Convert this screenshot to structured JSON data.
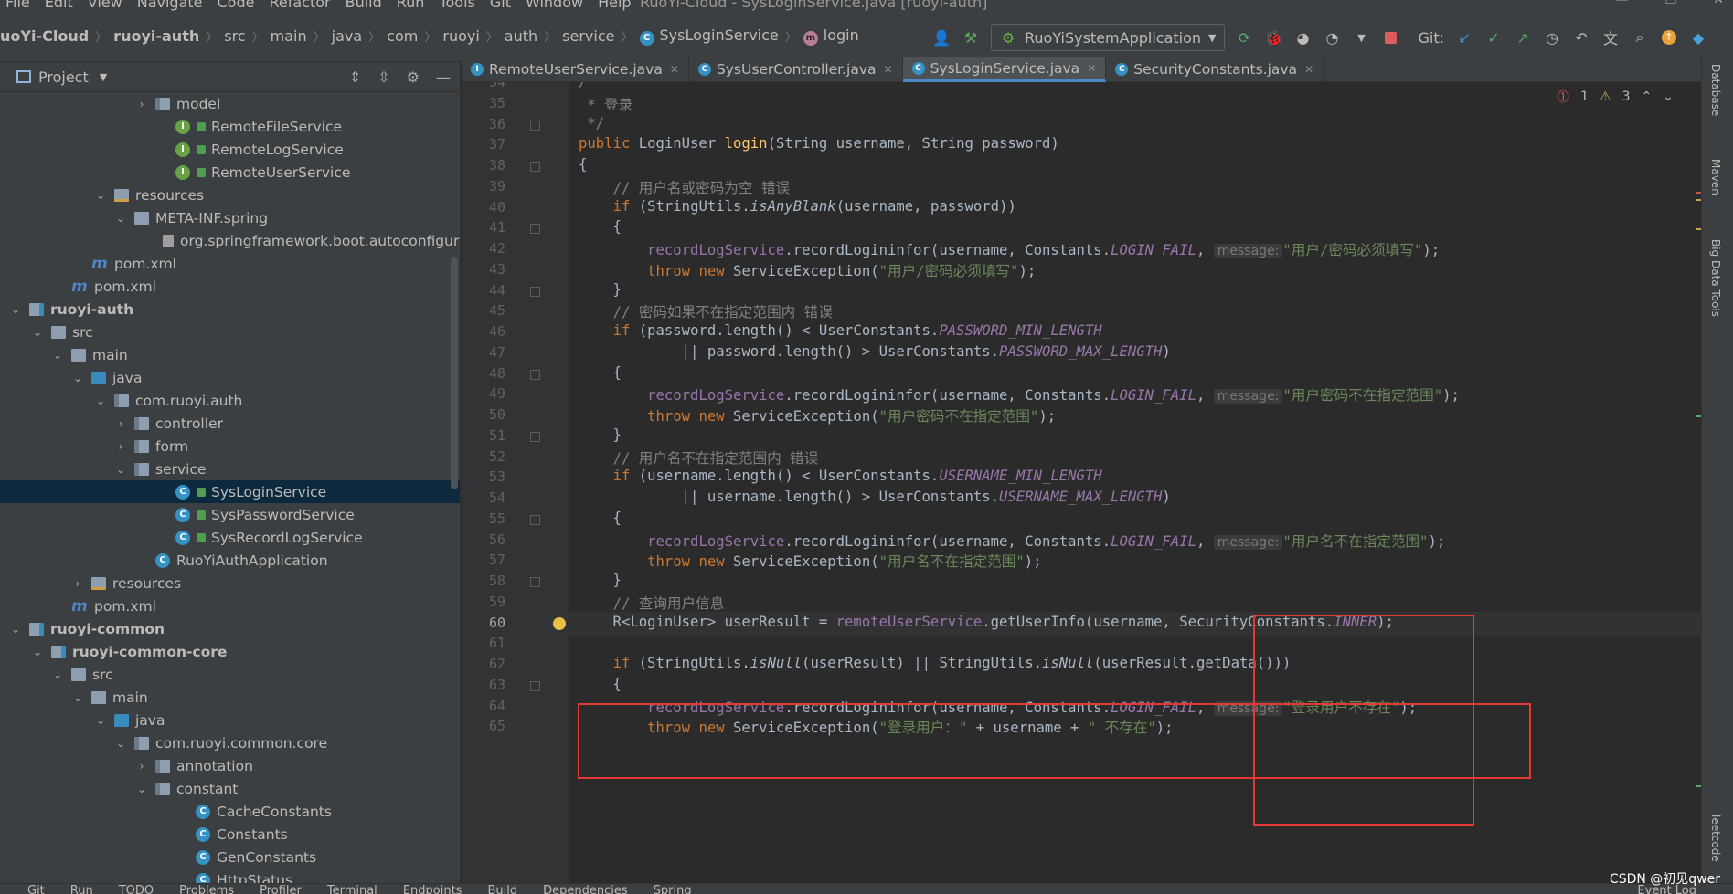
{
  "menubar": {
    "items": [
      "File",
      "Edit",
      "View",
      "Navigate",
      "Code",
      "Refactor",
      "Build",
      "Run",
      "Tools",
      "Git",
      "Window",
      "Help"
    ],
    "title": "RuoYi-Cloud - SysLoginService.java [ruoyi-auth]"
  },
  "breadcrumb": {
    "items": [
      "uoYi-Cloud",
      "ruoyi-auth",
      "src",
      "main",
      "java",
      "com",
      "ruoyi",
      "auth",
      "service",
      "SysLoginService",
      "login"
    ]
  },
  "toolbar": {
    "run_config": "RuoYiSystemApplication",
    "git_label": "Git:"
  },
  "project": {
    "title": "Project",
    "tree": [
      {
        "indent": 170,
        "arrow": "›",
        "icon": "pkg",
        "label": "model"
      },
      {
        "indent": 192,
        "arrow": "",
        "icon": "iface",
        "lock": true,
        "label": "RemoteFileService"
      },
      {
        "indent": 192,
        "arrow": "",
        "icon": "iface",
        "lock": true,
        "label": "RemoteLogService"
      },
      {
        "indent": 192,
        "arrow": "",
        "icon": "iface",
        "lock": true,
        "label": "RemoteUserService"
      },
      {
        "indent": 125,
        "arrow": "⌄",
        "icon": "resfolder",
        "label": "resources"
      },
      {
        "indent": 147,
        "arrow": "⌄",
        "icon": "folder",
        "label": "META-INF.spring"
      },
      {
        "indent": 192,
        "arrow": "",
        "icon": "file",
        "label": "org.springframework.boot.autoconfigure"
      },
      {
        "indent": 100,
        "arrow": "",
        "icon": "pom",
        "label": "pom.xml"
      },
      {
        "indent": 78,
        "arrow": "",
        "icon": "pom",
        "label": "pom.xml"
      },
      {
        "indent": 32,
        "arrow": "⌄",
        "icon": "mod",
        "label": "ruoyi-auth",
        "bold": true
      },
      {
        "indent": 56,
        "arrow": "⌄",
        "icon": "folder",
        "label": "src"
      },
      {
        "indent": 78,
        "arrow": "⌄",
        "icon": "folder",
        "label": "main"
      },
      {
        "indent": 100,
        "arrow": "⌄",
        "icon": "srcfolder",
        "label": "java"
      },
      {
        "indent": 125,
        "arrow": "⌄",
        "icon": "pkg",
        "label": "com.ruoyi.auth"
      },
      {
        "indent": 147,
        "arrow": "›",
        "icon": "pkg",
        "label": "controller"
      },
      {
        "indent": 147,
        "arrow": "›",
        "icon": "pkg",
        "label": "form"
      },
      {
        "indent": 147,
        "arrow": "⌄",
        "icon": "pkg",
        "label": "service"
      },
      {
        "indent": 192,
        "arrow": "",
        "icon": "class",
        "lock": true,
        "label": "SysLoginService",
        "selected": true
      },
      {
        "indent": 192,
        "arrow": "",
        "icon": "class",
        "lock": true,
        "label": "SysPasswordService"
      },
      {
        "indent": 192,
        "arrow": "",
        "icon": "class",
        "lock": true,
        "label": "SysRecordLogService"
      },
      {
        "indent": 170,
        "arrow": "",
        "icon": "class",
        "label": "RuoYiAuthApplication"
      },
      {
        "indent": 100,
        "arrow": "›",
        "icon": "resfolder",
        "label": "resources"
      },
      {
        "indent": 78,
        "arrow": "",
        "icon": "pom",
        "label": "pom.xml"
      },
      {
        "indent": 32,
        "arrow": "⌄",
        "icon": "mod",
        "label": "ruoyi-common",
        "bold": true
      },
      {
        "indent": 56,
        "arrow": "⌄",
        "icon": "mod",
        "label": "ruoyi-common-core",
        "bold": true
      },
      {
        "indent": 78,
        "arrow": "⌄",
        "icon": "folder",
        "label": "src"
      },
      {
        "indent": 100,
        "arrow": "⌄",
        "icon": "folder",
        "label": "main"
      },
      {
        "indent": 125,
        "arrow": "⌄",
        "icon": "srcfolder",
        "label": "java"
      },
      {
        "indent": 147,
        "arrow": "⌄",
        "icon": "pkg",
        "label": "com.ruoyi.common.core"
      },
      {
        "indent": 170,
        "arrow": "›",
        "icon": "pkg",
        "label": "annotation"
      },
      {
        "indent": 170,
        "arrow": "⌄",
        "icon": "pkg",
        "label": "constant"
      },
      {
        "indent": 214,
        "arrow": "",
        "icon": "class",
        "label": "CacheConstants"
      },
      {
        "indent": 214,
        "arrow": "",
        "icon": "class",
        "label": "Constants"
      },
      {
        "indent": 214,
        "arrow": "",
        "icon": "class",
        "label": "GenConstants"
      },
      {
        "indent": 214,
        "arrow": "",
        "icon": "class",
        "label": "HttpStatus"
      }
    ]
  },
  "tabs": [
    {
      "label": "RemoteUserService.java",
      "icon": "iface"
    },
    {
      "label": "SysUserController.java",
      "icon": "class"
    },
    {
      "label": "SysLoginService.java",
      "icon": "class",
      "active": true
    },
    {
      "label": "SecurityConstants.java",
      "icon": "class"
    }
  ],
  "inspections": {
    "errors": "1",
    "warnings": "3"
  },
  "editor": {
    "first_line": 34,
    "lines": [
      "<span class='c'>/**</span>",
      "<span class='c'> * 登录</span>",
      "<span class='c'> */</span>",
      "<span class='k'>public </span>LoginUser <span class='f'>login</span>(String username, String password)",
      "{",
      "    <span class='c'>// 用户名或密码为空 错误</span>",
      "    <span class='k'>if </span>(StringUtils.<span class='it'>isAnyBlank</span>(username, password))",
      "    {",
      "        <span class='fl'>recordLogService</span>.recordLogininfor(username, Constants.<span class='st'>LOGIN_FAIL</span>, <span class='hint'>message:</span><span class='s'>\"用户/密码必须填写\"</span>);",
      "        <span class='k'>throw new </span>ServiceException(<span class='s'>\"用户/密码必须填写\"</span>);",
      "    }",
      "    <span class='c'>// 密码如果不在指定范围内 错误</span>",
      "    <span class='k'>if </span>(password.length() &lt; UserConstants.<span class='st'>PASSWORD_MIN_LENGTH</span>",
      "            || password.length() &gt; UserConstants.<span class='st'>PASSWORD_MAX_LENGTH</span>)",
      "    {",
      "        <span class='fl'>recordLogService</span>.recordLogininfor(username, Constants.<span class='st'>LOGIN_FAIL</span>, <span class='hint'>message:</span><span class='s'>\"用户密码不在指定范围\"</span>);",
      "        <span class='k'>throw new </span>ServiceException(<span class='s'>\"用户密码不在指定范围\"</span>);",
      "    }",
      "    <span class='c'>// 用户名不在指定范围内 错误</span>",
      "    <span class='k'>if </span>(username.length() &lt; UserConstants.<span class='st'>USERNAME_MIN_LENGTH</span>",
      "            || username.length() &gt; UserConstants.<span class='st'>USERNAME_MAX_LENGTH</span>)",
      "    {",
      "        <span class='fl'>recordLogService</span>.recordLogininfor(username, Constants.<span class='st'>LOGIN_FAIL</span>, <span class='hint'>message:</span><span class='s'>\"用户名不在指定范围\"</span>);",
      "        <span class='k'>throw new </span>ServiceException(<span class='s'>\"用户名不在指定范围\"</span>);",
      "    }",
      "    <span class='c'>// 查询用户信息</span>",
      "    R&lt;LoginUser&gt; userResult = <span class='fl'>remoteUserService</span>.getUserInfo(username, SecurityConstants.<span class='st'>INNER</span>);",
      "",
      "    <span class='k'>if </span>(StringUtils.<span class='it'>isNull</span>(userResult) || StringUtils.<span class='it'>isNull</span>(userResult.getData()))",
      "    {",
      "        <span class='fl'>recordLogService</span>.recordLogininfor(username, Constants.<span class='st'>LOGIN_FAIL</span>, <span class='hint'>message:</span><span class='s'>\"登录用户不存在\"</span>);",
      "        <span class='k'>throw new </span>ServiceException(<span class='s'>\"登录用户：\" </span>+ username + <span class='s'>\" 不存在\"</span>);"
    ],
    "current_line": 60
  },
  "right_strip": [
    "Database",
    "Maven",
    "Big Data Tools",
    "leetcode"
  ],
  "bottom_tools": [
    "Git",
    "Run",
    "TODO",
    "Problems",
    "Profiler",
    "Terminal",
    "Endpoints",
    "Build",
    "Dependencies",
    "Spring"
  ],
  "event_log": "Event Log",
  "watermark": "CSDN @初见qwer",
  "colors": {
    "accent": "#4a88c7",
    "annotation_box": "#e53935"
  }
}
